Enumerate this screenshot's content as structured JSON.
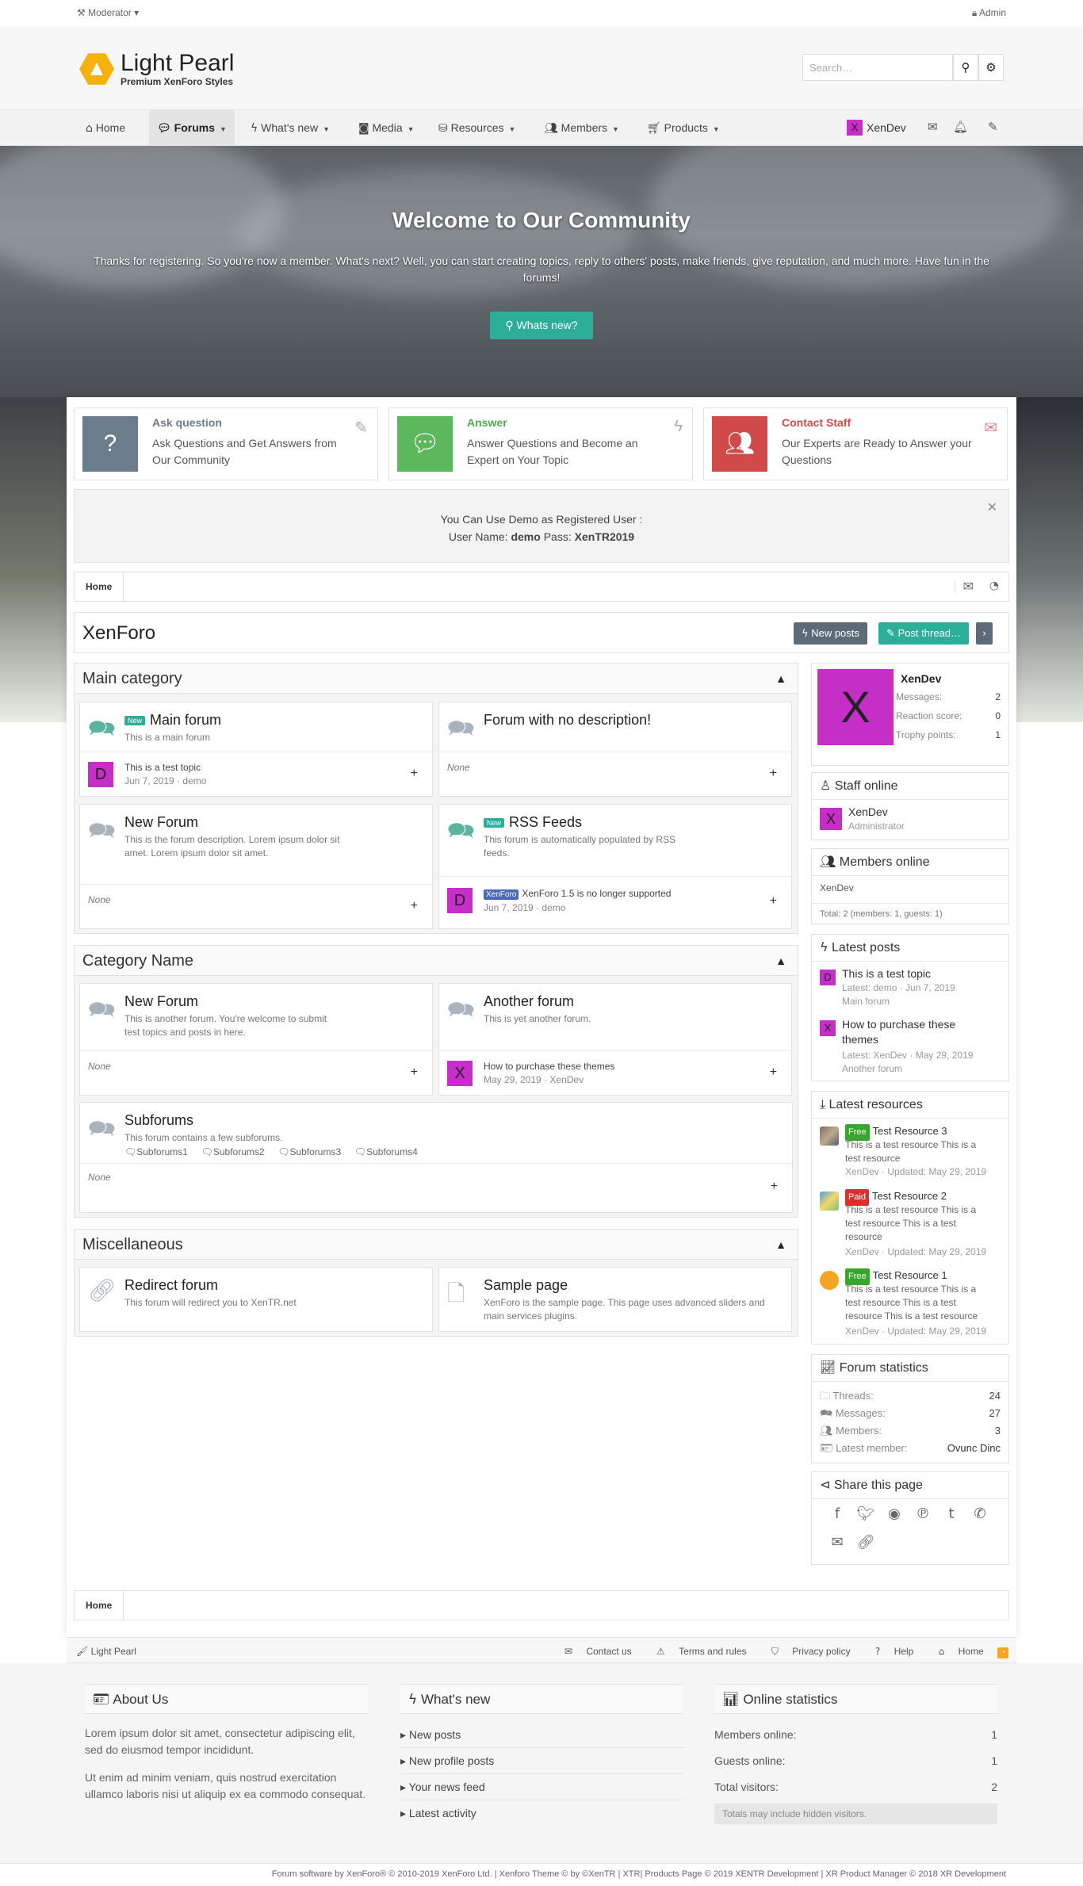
{
  "topbar": {
    "moderator": "Moderator",
    "admin": "Admin"
  },
  "logo": {
    "title": "Light Pearl",
    "subtitle": "Premium XenForo Styles"
  },
  "search": {
    "placeholder": "Search…"
  },
  "nav": {
    "tabs": [
      {
        "label": "Home"
      },
      {
        "label": "Forums"
      },
      {
        "label": "What's new"
      },
      {
        "label": "Media"
      },
      {
        "label": "Resources"
      },
      {
        "label": "Members"
      },
      {
        "label": "Products"
      }
    ],
    "user": "XenDev",
    "user_initial": "X"
  },
  "hero": {
    "title": "Welcome to Our Community",
    "text": "Thanks for registering. So you're now a member. What's next? Well, you can start creating topics, reply to others' posts, make friends, give reputation, and much more. Have fun in the forums!",
    "button": "Whats new?"
  },
  "features": [
    {
      "title": "Ask question",
      "desc": "Ask Questions and Get Answers from Our Community",
      "color": "#6b7c8c",
      "title_color": "#6b7c8c"
    },
    {
      "title": "Answer",
      "desc": "Answer Questions and Become an Expert on Your Topic",
      "color": "#5cb85c",
      "title_color": "#4cae4c"
    },
    {
      "title": "Contact Staff",
      "desc": "Our Experts are Ready to Answer your Questions",
      "color": "#d14a4a",
      "title_color": "#d14a4a"
    }
  ],
  "notice": {
    "line1": "You Can Use Demo as Registered User :",
    "user_label": "User Name:",
    "user": "demo",
    "pass_label": "Pass:",
    "pass": "XenTR2019"
  },
  "breadcrumb": {
    "home": "Home"
  },
  "page": {
    "title": "XenForo",
    "new_posts": "New posts",
    "post_thread": "Post thread…"
  },
  "categories": {
    "main": {
      "title": "Main category"
    },
    "catname": {
      "title": "Category Name"
    },
    "misc": {
      "title": "Miscellaneous"
    }
  },
  "nodes": {
    "main_forum": {
      "badge": "New",
      "title": "Main forum",
      "desc": "This is a main forum",
      "last_title": "This is a test topic",
      "last_date": "Jun 7, 2019",
      "last_user": "demo",
      "avatar": "D"
    },
    "no_desc": {
      "title": "Forum with no description!",
      "none": "None"
    },
    "new_forum": {
      "title": "New Forum",
      "desc": "This is the forum description. Lorem ipsum dolor sit amet. Lorem ipsum dolor sit amet.",
      "none": "None"
    },
    "rss": {
      "badge": "New",
      "title": "RSS Feeds",
      "desc": "This forum is automatically populated by RSS feeds.",
      "tag": "XenForo",
      "last_title": "XenForo 1.5 is no longer supported",
      "last_date": "Jun 7, 2019",
      "last_user": "demo",
      "avatar": "D"
    },
    "new_forum2": {
      "title": "New Forum",
      "desc": "This is another forum. You're welcome to submit test topics and posts in here.",
      "none": "None"
    },
    "another": {
      "title": "Another forum",
      "desc": "This is yet another forum.",
      "last_title": "How to purchase these themes",
      "last_date": "May 29, 2019",
      "last_user": "XenDev",
      "avatar": "X"
    },
    "subforums": {
      "title": "Subforums",
      "desc": "This forum contains a few subforums.",
      "subs": [
        "Subforums1",
        "Subforums2",
        "Subforums3",
        "Subforums4"
      ],
      "none": "None"
    },
    "redirect": {
      "title": "Redirect forum",
      "desc": "This forum will redirect you to XenTR.net"
    },
    "sample": {
      "title": "Sample page",
      "desc": "XenForo is the sample page. This page uses advanced sliders and main services plugins."
    }
  },
  "sidebar": {
    "profile": {
      "name": "XenDev",
      "initial": "X",
      "messages_label": "Messages:",
      "messages": "2",
      "reaction_label": "Reaction score:",
      "reaction": "0",
      "trophy_label": "Trophy points:",
      "trophy": "1"
    },
    "staff": {
      "title": "Staff online",
      "name": "XenDev",
      "role": "Administrator",
      "initial": "X"
    },
    "members": {
      "title": "Members online",
      "list": "XenDev",
      "total": "Total: 2 (members: 1, guests: 1)"
    },
    "latest_posts": {
      "title": "Latest posts",
      "items": [
        {
          "title": "This is a test topic",
          "meta": "Latest: demo · Jun 7, 2019",
          "forum": "Main forum",
          "initial": "D"
        },
        {
          "title": "How to purchase these themes",
          "meta": "Latest: XenDev · May 29, 2019",
          "forum": "Another forum",
          "initial": "X"
        }
      ]
    },
    "resources": {
      "title": "Latest resources",
      "items": [
        {
          "label": "Free",
          "label_color": "#3aa52e",
          "title": "Test Resource 3",
          "desc": "This is a test resource This is a test resource",
          "meta": "XenDev · Updated: May 29, 2019"
        },
        {
          "label": "Paid",
          "label_color": "#d92f2f",
          "title": "Test Resource 2",
          "desc": "This is a test resource This is a test resource This is a test resource",
          "meta": "XenDev · Updated: May 29, 2019"
        },
        {
          "label": "Free",
          "label_color": "#3aa52e",
          "title": "Test Resource 1",
          "desc": "This is a test resource This is a test resource This is a test resource This is a test resource",
          "meta": "XenDev · Updated: May 29, 2019"
        }
      ]
    },
    "stats": {
      "title": "Forum statistics",
      "threads_label": "Threads:",
      "threads": "24",
      "messages_label": "Messages:",
      "messages": "27",
      "members_label": "Members:",
      "members": "3",
      "latest_label": "Latest member:",
      "latest": "Ovunc Dinc"
    },
    "share": {
      "title": "Share this page"
    }
  },
  "footer": {
    "style": "Light Pearl",
    "links": [
      "Contact us",
      "Terms and rules",
      "Privacy policy",
      "Help",
      "Home"
    ],
    "about": {
      "title": "About Us",
      "p1": "Lorem ipsum dolor sit amet, consectetur adipiscing elit, sed do eiusmod tempor incididunt.",
      "p2": "Ut enim ad minim veniam, quis nostrud exercitation ullamco laboris nisi ut aliquip ex ea commodo consequat."
    },
    "whatsnew": {
      "title": "What's new",
      "links": [
        "New posts",
        "New profile posts",
        "Your news feed",
        "Latest activity"
      ]
    },
    "online": {
      "title": "Online statistics",
      "members_label": "Members online:",
      "members": "1",
      "guests_label": "Guests online:",
      "guests": "1",
      "total_label": "Total visitors:",
      "total": "2",
      "note": "Totals may include hidden visitors."
    },
    "copyright": "Forum software by XenForo® © 2010-2019 XenForo Ltd. | Xenforo Theme © by ©XenTR | XTR| Products Page © 2019 XENTR Development | XR Product Manager © 2018 XR Development"
  }
}
